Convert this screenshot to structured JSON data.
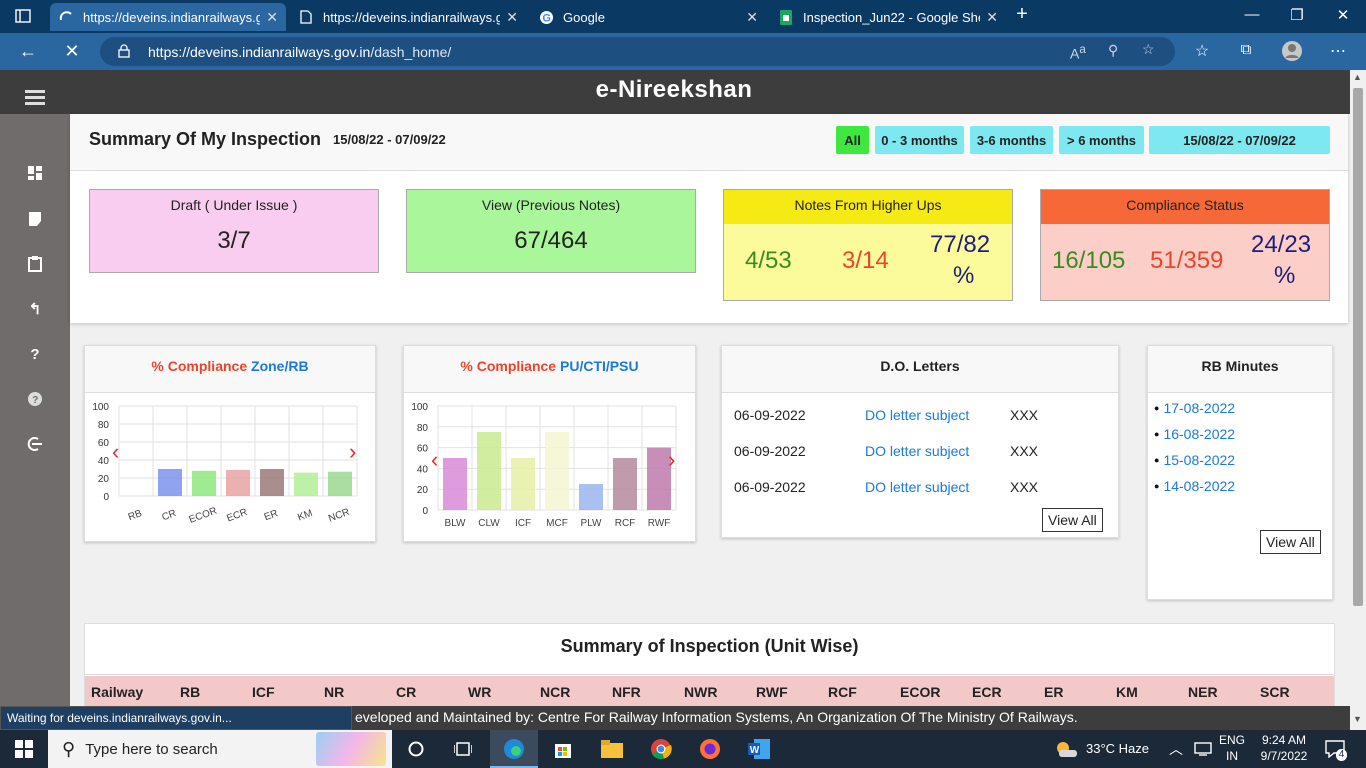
{
  "browser": {
    "tabs": [
      {
        "label": "https://deveins.indianrailways.go",
        "active": true
      },
      {
        "label": "https://deveins.indianrailways.go",
        "active": false
      },
      {
        "label": "Google",
        "active": false
      },
      {
        "label": "Inspection_Jun22 - Google Sheet",
        "active": false
      }
    ],
    "url_host": "https://deveins.indianrailways.gov.in",
    "url_path": "/dash_home/"
  },
  "app": {
    "title": "e-Nireekshan"
  },
  "summary": {
    "title": "Summary Of My Inspection",
    "range": "15/08/22 - 07/09/22",
    "filters": [
      "All",
      "0 - 3 months",
      "3-6 months",
      "> 6 months",
      "15/08/22 - 07/09/22"
    ],
    "cards": {
      "draft": {
        "title": "Draft ( Under Issue )",
        "value": "3/7"
      },
      "view": {
        "title": "View (Previous Notes)",
        "value": "67/464"
      },
      "higher": {
        "title": "Notes From Higher Ups",
        "v1": "4/53",
        "v2": "3/14",
        "v3": "77/82",
        "v3_unit": "%"
      },
      "compliance": {
        "title": "Compliance Status",
        "v1": "16/105",
        "v2": "51/359",
        "v3": "24/23",
        "v3_unit": "%"
      }
    }
  },
  "charts": {
    "zone_title_red": "% Compliance ",
    "zone_title_blue": "Zone/RB",
    "pu_title_red": "% Compliance ",
    "pu_title_blue": "PU/CTI/PSU"
  },
  "chart_data": [
    {
      "type": "bar",
      "title": "% Compliance Zone/RB",
      "categories": [
        "RB",
        "CR",
        "ECOR",
        "ECR",
        "ER",
        "KM",
        "NCR"
      ],
      "values": [
        0,
        30,
        28,
        29,
        30,
        26,
        27
      ],
      "ylim": [
        0,
        100
      ],
      "yticks": [
        0,
        20,
        40,
        60,
        80,
        100
      ],
      "colors": [
        "#8fa8f0",
        "#7b93ee",
        "#8ee87c",
        "#e8a2a2",
        "#9b7a7a",
        "#b2ee98",
        "#9bd88e"
      ]
    },
    {
      "type": "bar",
      "title": "% Compliance PU/CTI/PSU",
      "categories": [
        "BLW",
        "CLW",
        "ICF",
        "MCF",
        "PLW",
        "RCF",
        "RWF"
      ],
      "values": [
        50,
        75,
        50,
        75,
        25,
        50,
        60
      ],
      "ylim": [
        0,
        100
      ],
      "yticks": [
        0,
        20,
        40,
        60,
        80,
        100
      ],
      "colors": [
        "#d88ad8",
        "#c9ea8e",
        "#e6f0a6",
        "#f4f4d2",
        "#9bb5ee",
        "#b58a9e",
        "#c07aaa"
      ]
    }
  ],
  "do_letters": {
    "title": "D.O. Letters",
    "rows": [
      {
        "date": "06-09-2022",
        "subject": "DO letter subject",
        "ref": "XXX"
      },
      {
        "date": "06-09-2022",
        "subject": "DO letter subject",
        "ref": "XXX"
      },
      {
        "date": "06-09-2022",
        "subject": "DO letter subject",
        "ref": "XXX"
      }
    ],
    "view_all": "View All"
  },
  "rb_minutes": {
    "title": "RB Minutes",
    "items": [
      "17-08-2022",
      "16-08-2022",
      "15-08-2022",
      "14-08-2022"
    ],
    "view_all": "View All"
  },
  "unit_wise": {
    "title": "Summary of Inspection (Unit Wise)",
    "columns": [
      "Railway",
      "RB",
      "ICF",
      "NR",
      "CR",
      "WR",
      "NCR",
      "NFR",
      "NWR",
      "RWF",
      "RCF",
      "ECOR",
      "ECR",
      "ER",
      "KM",
      "NER",
      "SCR"
    ]
  },
  "footer": {
    "text": "eveloped and Maintained by: Centre For Railway Information Systems, An Organization Of The Ministry Of Railways."
  },
  "status": {
    "text": "Waiting for deveins.indianrailways.gov.in..."
  },
  "taskbar": {
    "search_placeholder": "Type here to search",
    "weather": "33°C  Haze",
    "lang": "ENG",
    "region": "IN",
    "time": "9:24 AM",
    "date": "9/7/2022",
    "notifications": "4"
  }
}
